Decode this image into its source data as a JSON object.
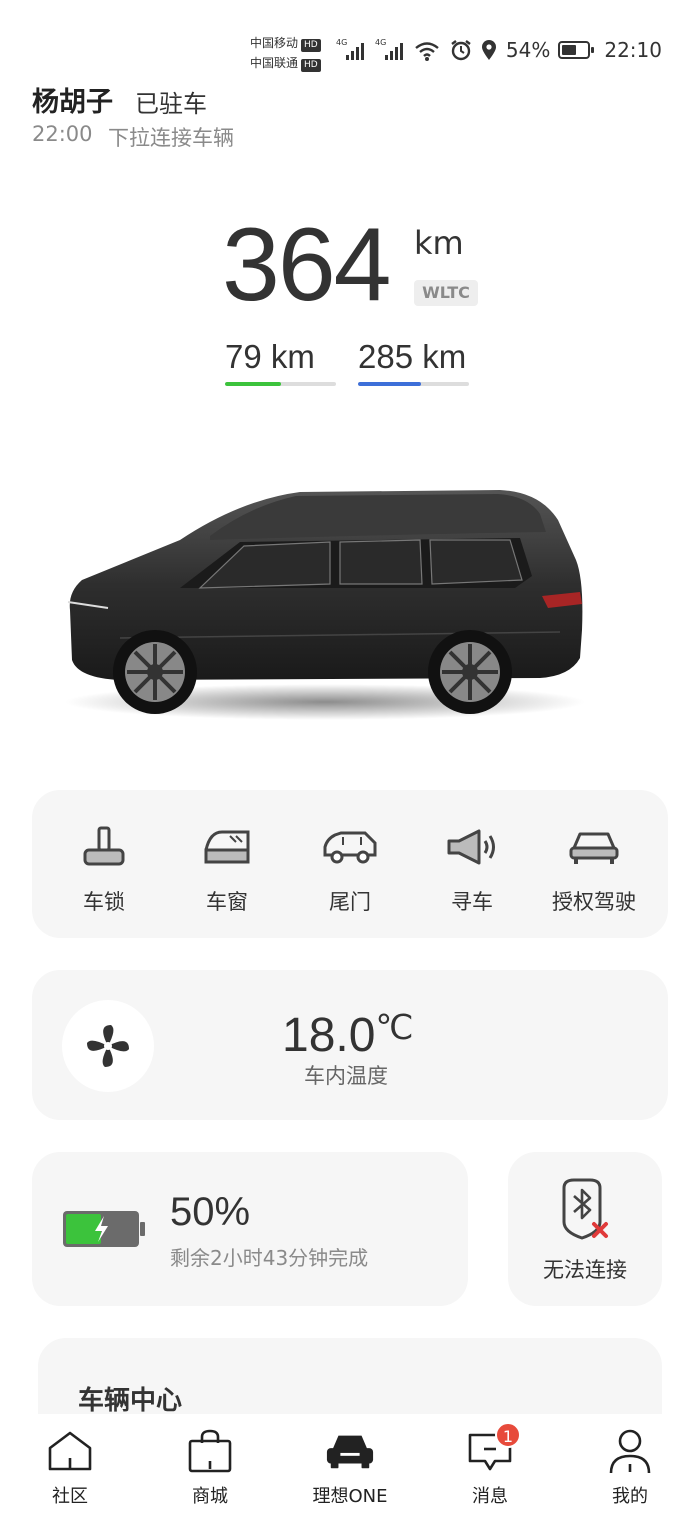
{
  "status_bar": {
    "carrier1": "中国移动",
    "carrier2": "中国联通",
    "hd": "HD",
    "net1": "4G",
    "net2": "4G",
    "battery": "54%",
    "time": "22:10",
    "icons": [
      "wifi-icon",
      "alarm-icon",
      "location-icon",
      "battery-icon"
    ]
  },
  "header": {
    "vehicle_name": "杨胡子",
    "status": "已驻车",
    "time": "22:00",
    "hint": "下拉连接车辆"
  },
  "range": {
    "total": "364",
    "unit": "km",
    "standard": "WLTC",
    "electric": "79 km",
    "electric_color": "#3cc33c",
    "electric_fraction": 0.5,
    "fuel": "285 km",
    "fuel_color": "#3d6fd9",
    "fuel_fraction": 0.57
  },
  "controls": [
    {
      "label": "车锁",
      "icon": "lock-icon"
    },
    {
      "label": "车窗",
      "icon": "window-icon"
    },
    {
      "label": "尾门",
      "icon": "tailgate-icon"
    },
    {
      "label": "寻车",
      "icon": "horn-icon"
    },
    {
      "label": "授权驾驶",
      "icon": "authorize-drive-icon"
    }
  ],
  "climate": {
    "temperature": "18.0",
    "unit": "℃",
    "label": "车内温度",
    "icon": "fan-icon"
  },
  "charging": {
    "percent": "50%",
    "level": 0.5,
    "remaining": "剩余2小时43分钟完成",
    "icon": "charging-battery-icon",
    "accent": "#3cc33c"
  },
  "bluetooth_key": {
    "label": "无法连接",
    "icon": "bluetooth-key-disconnected-icon"
  },
  "vehicle_center": {
    "title": "车辆中心"
  },
  "nav": [
    {
      "label": "社区",
      "icon": "home-icon"
    },
    {
      "label": "商城",
      "icon": "shopping-bag-icon"
    },
    {
      "label": "理想ONE",
      "icon": "car-icon",
      "active": true
    },
    {
      "label": "消息",
      "icon": "message-icon",
      "badge": "1"
    },
    {
      "label": "我的",
      "icon": "person-icon"
    }
  ]
}
